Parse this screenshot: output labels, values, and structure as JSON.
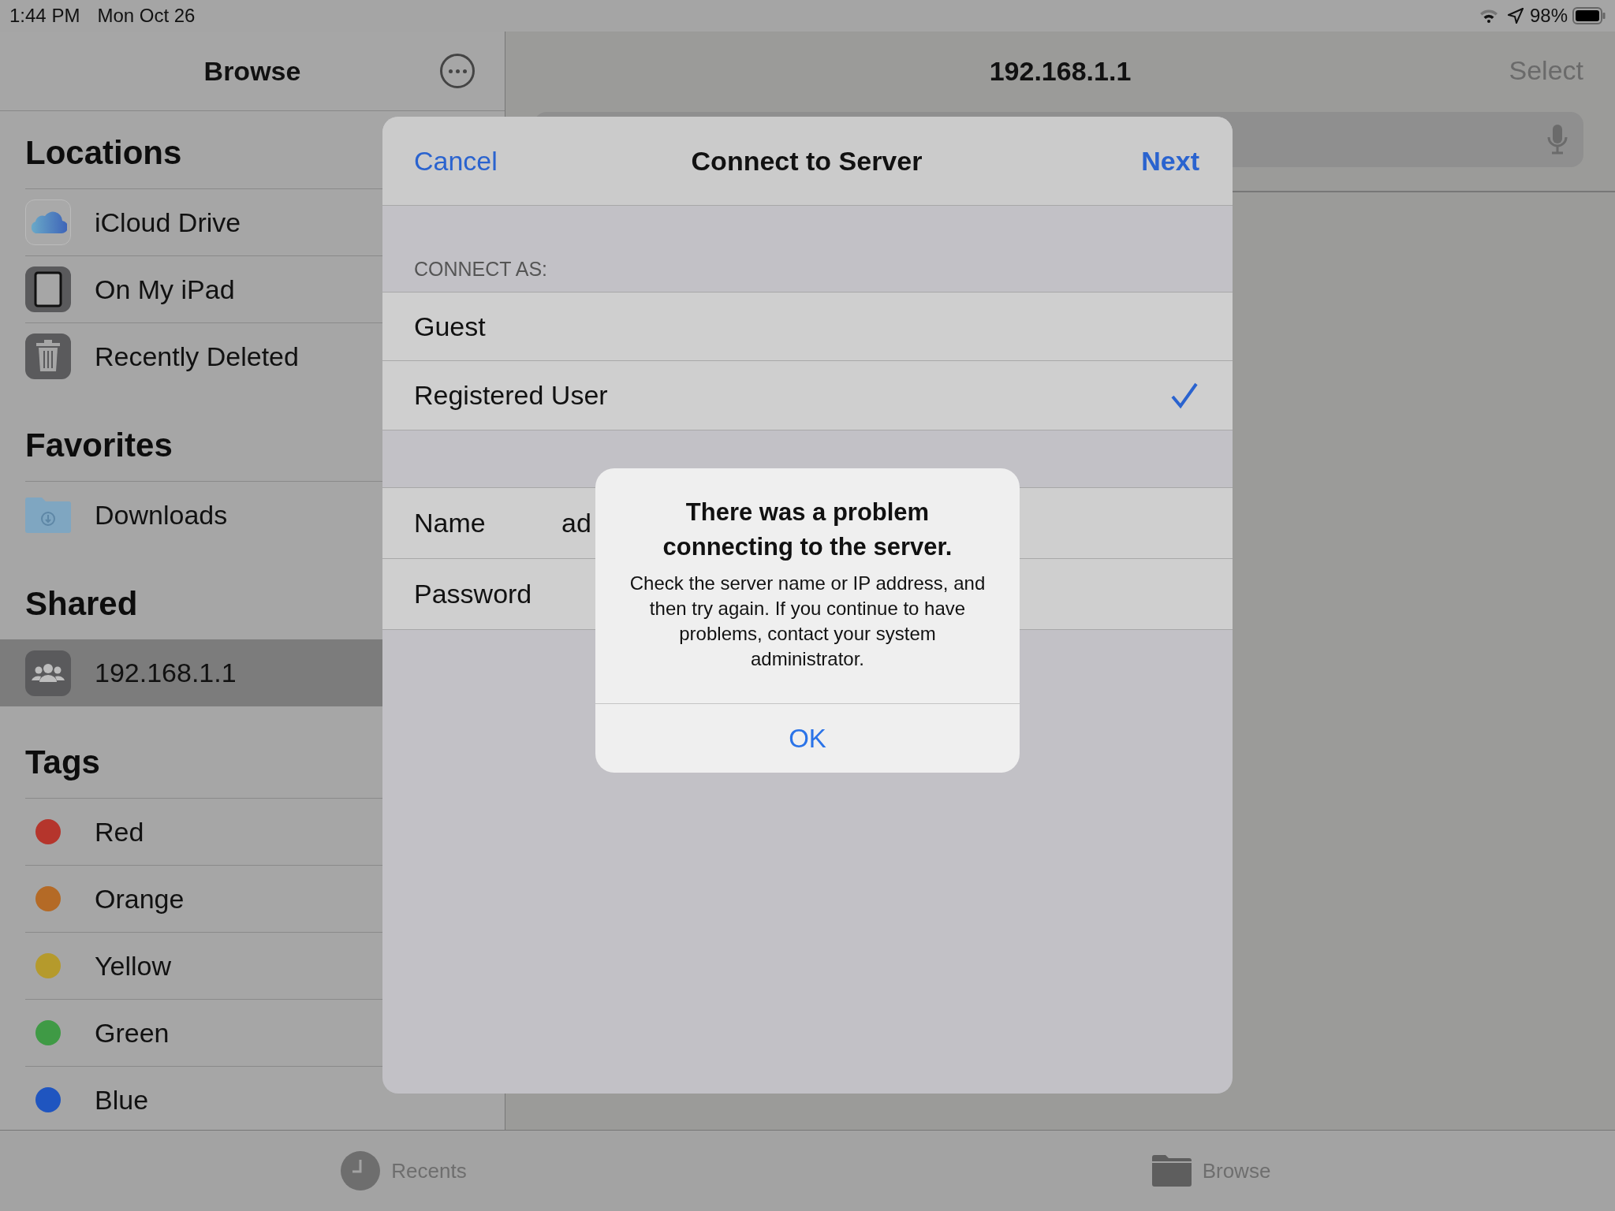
{
  "status_bar": {
    "time": "1:44 PM",
    "date": "Mon Oct 26",
    "battery": "98%"
  },
  "sidebar": {
    "title": "Browse",
    "sections": [
      {
        "title": "Locations",
        "items": [
          {
            "kind": "icloud",
            "label": "iCloud Drive",
            "selected": false
          },
          {
            "kind": "ipad",
            "label": "On My iPad",
            "selected": false
          },
          {
            "kind": "trash",
            "label": "Recently Deleted",
            "selected": false
          }
        ]
      },
      {
        "title": "Favorites",
        "items": [
          {
            "kind": "downloads",
            "label": "Downloads",
            "selected": false
          }
        ]
      },
      {
        "title": "Shared",
        "items": [
          {
            "kind": "server",
            "label": "192.168.1.1",
            "selected": true
          }
        ]
      },
      {
        "title": "Tags",
        "items": [
          {
            "kind": "tag",
            "label": "Red",
            "color": "#b5352c",
            "selected": false
          },
          {
            "kind": "tag",
            "label": "Orange",
            "color": "#b46a26",
            "selected": false
          },
          {
            "kind": "tag",
            "label": "Yellow",
            "color": "#b59a2c",
            "selected": false
          },
          {
            "kind": "tag",
            "label": "Green",
            "color": "#3f9a45",
            "selected": false
          },
          {
            "kind": "tag",
            "label": "Blue",
            "color": "#1f55c0",
            "selected": false
          }
        ]
      }
    ]
  },
  "content": {
    "title": "192.168.1.1",
    "select": "Select"
  },
  "dialog": {
    "cancel": "Cancel",
    "title": "Connect to Server",
    "next": "Next",
    "section_label": "CONNECT AS:",
    "options": [
      {
        "label": "Guest",
        "selected": false
      },
      {
        "label": "Registered User",
        "selected": true
      }
    ],
    "fields": [
      {
        "label": "Name",
        "value": "ad"
      },
      {
        "label": "Password"
      }
    ]
  },
  "alert": {
    "title": "There was a problem connecting to the server.",
    "message": "Check the server name or IP address, and then try again. If you continue to have problems, contact your system administrator.",
    "button": "OK"
  },
  "tab_bar": [
    {
      "kind": "recents",
      "label": "Recents"
    },
    {
      "kind": "browse",
      "label": "Browse"
    }
  ]
}
